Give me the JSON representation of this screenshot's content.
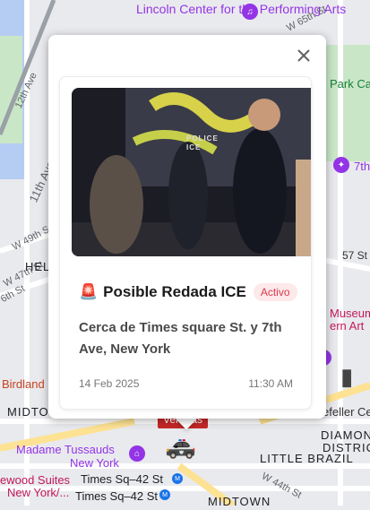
{
  "map": {
    "labels": {
      "lincoln": "Lincoln Center for the Performing Arts",
      "w65": "W 65th St",
      "twelfth_ave": "12th Ave",
      "eleventh_ave": "11th Ave",
      "park_ca": "Park Ca",
      "seventh": "7th",
      "w49": "W 49th S",
      "w47": "W 47th St",
      "w46": "6th St",
      "hel": "HEL",
      "fifty_seventh": "57 St",
      "museum": "Museum",
      "modern_art": "ern Art",
      "birdland": "Birdland",
      "midtown": "MIDTO",
      "rockefeller": "efeller Ce",
      "diamond": "DIAMON",
      "district": "DISTRIC",
      "little_brazil": "LITTLE BRAZIL",
      "tussauds_1": "Madame Tussauds",
      "tussauds_2": "New York",
      "times_sq_1": "Times Sq–42 St",
      "times_sq_2": "Times Sq–42 St",
      "wood_suites": "ewood Suites",
      "new_york": "New York/...",
      "w44": "W 44th St",
      "midtown_bottom": "MIDTOWN"
    },
    "marker_label": "Veredas"
  },
  "popup": {
    "close_label": "✕",
    "card": {
      "badge_icon": "🚨",
      "title": "Posible Redada ICE",
      "status": "Activo",
      "location": "Cerca de Times square St. y 7th Ave, New York",
      "date": "14 Feb 2025",
      "time": "11:30 AM",
      "photo_text": "POLICE ICE"
    }
  }
}
